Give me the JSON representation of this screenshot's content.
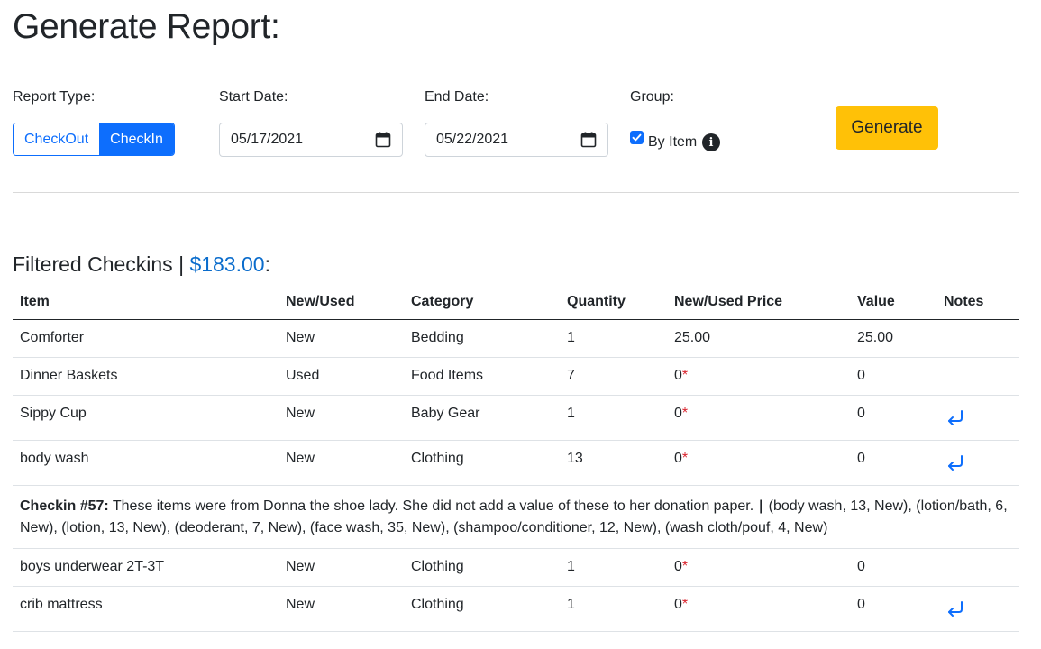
{
  "page_title": "Generate Report:",
  "controls": {
    "report_type_label": "Report Type:",
    "report_type_options": [
      "CheckOut",
      "CheckIn"
    ],
    "report_type_selected": "CheckIn",
    "start_date_label": "Start Date:",
    "start_date_value": "05/17/2021",
    "end_date_label": "End Date:",
    "end_date_value": "05/22/2021",
    "group_label": "Group:",
    "group_by_item_label": "By Item",
    "group_by_item_checked": true,
    "generate_label": "Generate"
  },
  "section": {
    "title_prefix": "Filtered Checkins | ",
    "total": "$183.00",
    "title_suffix": ":"
  },
  "table": {
    "headers": [
      "Item",
      "New/Used",
      "Category",
      "Quantity",
      "New/Used Price",
      "Value",
      "Notes"
    ],
    "rows": [
      {
        "item": "Comforter",
        "condition": "New",
        "category": "Bedding",
        "quantity": "1",
        "price": "25.00",
        "price_required": false,
        "value": "25.00",
        "has_note": false
      },
      {
        "item": "Dinner Baskets",
        "condition": "Used",
        "category": "Food Items",
        "quantity": "7",
        "price": "0",
        "price_required": true,
        "value": "0",
        "has_note": false
      },
      {
        "item": "Sippy Cup",
        "condition": "New",
        "category": "Baby Gear",
        "quantity": "1",
        "price": "0",
        "price_required": true,
        "value": "0",
        "has_note": true
      },
      {
        "item": "body wash",
        "condition": "New",
        "category": "Clothing",
        "quantity": "13",
        "price": "0",
        "price_required": true,
        "value": "0",
        "has_note": true
      },
      {
        "item": "boys underwear 2T-3T",
        "condition": "New",
        "category": "Clothing",
        "quantity": "1",
        "price": "0",
        "price_required": true,
        "value": "0",
        "has_note": false
      },
      {
        "item": "crib mattress",
        "condition": "New",
        "category": "Clothing",
        "quantity": "1",
        "price": "0",
        "price_required": true,
        "value": "0",
        "has_note": true
      }
    ],
    "expanded_note": {
      "label": "Checkin #57:",
      "text": "These items were from Donna the shoe lady. She did not add a value of these to her donation paper.",
      "separator": "|",
      "items": "(body wash, 13, New), (lotion/bath, 6, New), (lotion, 13, New), (deoderant, 7, New), (face wash, 35, New), (shampoo/conditioner, 12, New), (wash cloth/pouf, 4, New)"
    }
  },
  "colors": {
    "primary": "#0d6efd",
    "warning": "#ffc107",
    "total_amount": "#0a6ccc",
    "required_star": "#d9232d"
  },
  "icons": {
    "date_picker": "calendar-icon",
    "info": "info-icon",
    "note": "return-arrow-icon"
  }
}
